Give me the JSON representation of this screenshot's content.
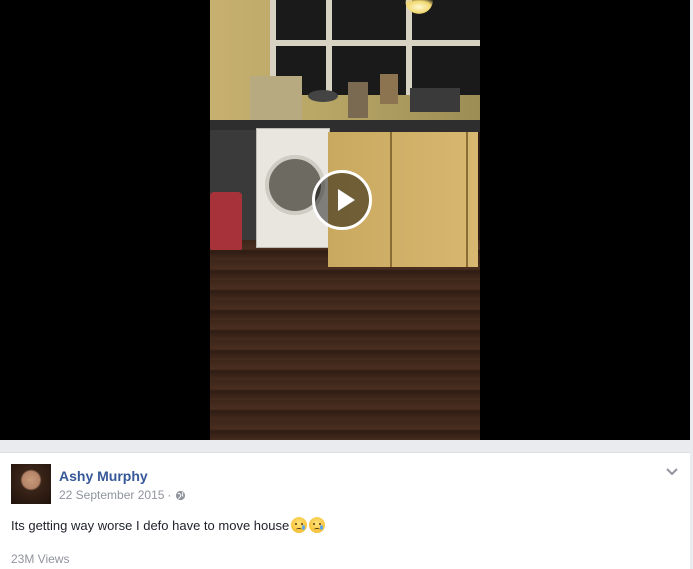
{
  "video": {
    "play_label": "Play video"
  },
  "post": {
    "author": "Ashy Murphy",
    "date": "22 September 2015",
    "separator": "·",
    "text": "Its getting way worse I defo have to move house",
    "emojis": [
      "crying-face-emoji",
      "crying-face-emoji"
    ],
    "views": "23M Views",
    "privacy_icon": "globe-icon",
    "menu_icon": "chevron-down-icon"
  },
  "colors": {
    "author_link": "#365899",
    "meta_text": "#90949c",
    "body_text": "#1d2129",
    "page_background": "#e9ebee",
    "video_background": "#000000"
  }
}
